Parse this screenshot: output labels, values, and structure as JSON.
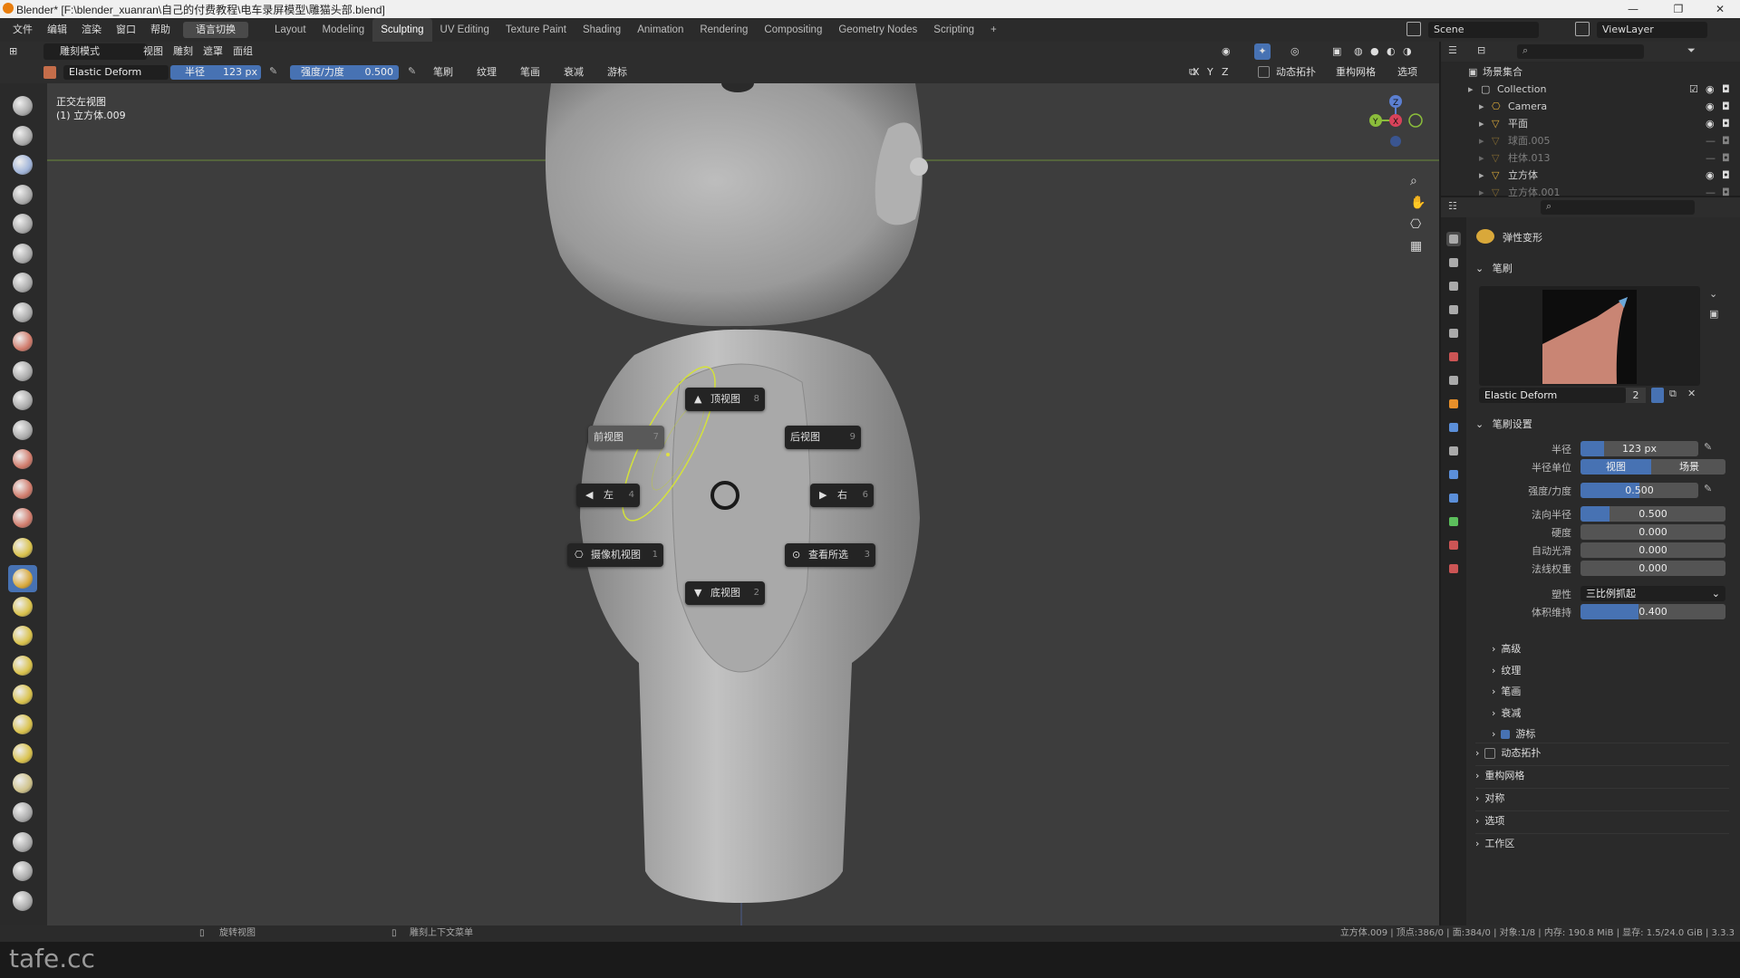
{
  "window": {
    "title": "Blender* [F:\\blender_xuanran\\自己的付费教程\\电车录屏模型\\雕猫头部.blend]"
  },
  "menu": {
    "items": [
      "文件",
      "编辑",
      "渲染",
      "窗口",
      "帮助"
    ],
    "lang_button": "语言切换"
  },
  "workspaces": {
    "tabs": [
      "Layout",
      "Modeling",
      "Sculpting",
      "UV Editing",
      "Texture Paint",
      "Shading",
      "Animation",
      "Rendering",
      "Compositing",
      "Geometry Nodes",
      "Scripting"
    ],
    "active": "Sculpting",
    "add": "+"
  },
  "scene": {
    "name": "Scene",
    "view_layer": "ViewLayer"
  },
  "viewport_header": {
    "mode": "雕刻模式",
    "menus": [
      "视图",
      "雕刻",
      "遮罩",
      "面组"
    ]
  },
  "tool_settings": {
    "brush_name": "Elastic Deform",
    "radius_label": "半径",
    "radius_value": "123 px",
    "strength_label": "强度/力度",
    "strength_value": "0.500",
    "menus": [
      "笔刷",
      "纹理",
      "笔画",
      "衰减",
      "游标"
    ],
    "axes": [
      "X",
      "Y",
      "Z"
    ],
    "right_menus": [
      "动态拓扑",
      "重构网格",
      "选项"
    ]
  },
  "viewport": {
    "view_name": "正交左视图",
    "object_name": "(1) 立方体.009"
  },
  "pie_menu": {
    "top": {
      "label": "顶视图",
      "key": "8"
    },
    "front": {
      "label": "前视图",
      "key": "7"
    },
    "back": {
      "label": "后视图",
      "key": "9"
    },
    "left": {
      "label": "左",
      "key": "4"
    },
    "right": {
      "label": "右",
      "key": "6"
    },
    "camera": {
      "label": "摄像机视图",
      "key": "1"
    },
    "selected": {
      "label": "查看所选",
      "key": "3"
    },
    "bottom": {
      "label": "底视图",
      "key": "2"
    }
  },
  "gizmo": {
    "z": "Z",
    "y": "Y",
    "x": "X"
  },
  "outliner": {
    "root": "场景集合",
    "rows": [
      {
        "name": "Collection",
        "visible": true
      },
      {
        "name": "Camera",
        "visible": true
      },
      {
        "name": "平面",
        "visible": true
      },
      {
        "name": "球面.005",
        "visible": false
      },
      {
        "name": "柱体.013",
        "visible": false
      },
      {
        "name": "立方体",
        "visible": true
      },
      {
        "name": "立方体.001",
        "visible": false
      }
    ]
  },
  "properties": {
    "brush_header": "弹性变形",
    "panel_brush": "笔刷",
    "brush_datablock": "Elastic Deform",
    "brush_users": "2",
    "panel_brush_settings": "笔刷设置",
    "fields": [
      {
        "label": "半径",
        "value": "123 px"
      },
      {
        "label": "半径单位",
        "value": "视图",
        "alt": "场景"
      },
      {
        "label": "强度/力度",
        "value": "0.500"
      },
      {
        "label": "法向半径",
        "value": "0.500"
      },
      {
        "label": "硬度",
        "value": "0.000"
      },
      {
        "label": "自动光滑",
        "value": "0.000"
      },
      {
        "label": "法线权重",
        "value": "0.000"
      },
      {
        "label": "塑性",
        "value": "三比例抓起"
      },
      {
        "label": "体积维持",
        "value": "0.400"
      }
    ],
    "subpanels": [
      "高级",
      "纹理",
      "笔画",
      "衰减",
      "游标"
    ],
    "panels": [
      "动态拓扑",
      "重构网格",
      "对称",
      "选项",
      "工作区"
    ]
  },
  "status": {
    "left_hint": "旋转视图",
    "mid_hint": "雕刻上下文菜单",
    "right": "立方体.009 | 顶点:386/0 | 面:384/0 | 对象:1/8 | 内存: 190.8 MiB | 显存: 1.5/24.0 GiB | 3.3.3"
  },
  "watermark": "tafe.cc",
  "colors": {
    "accent": "#4772b3",
    "viewport_bg": "#3d3d3d",
    "panel_bg": "#2a2a2a"
  }
}
